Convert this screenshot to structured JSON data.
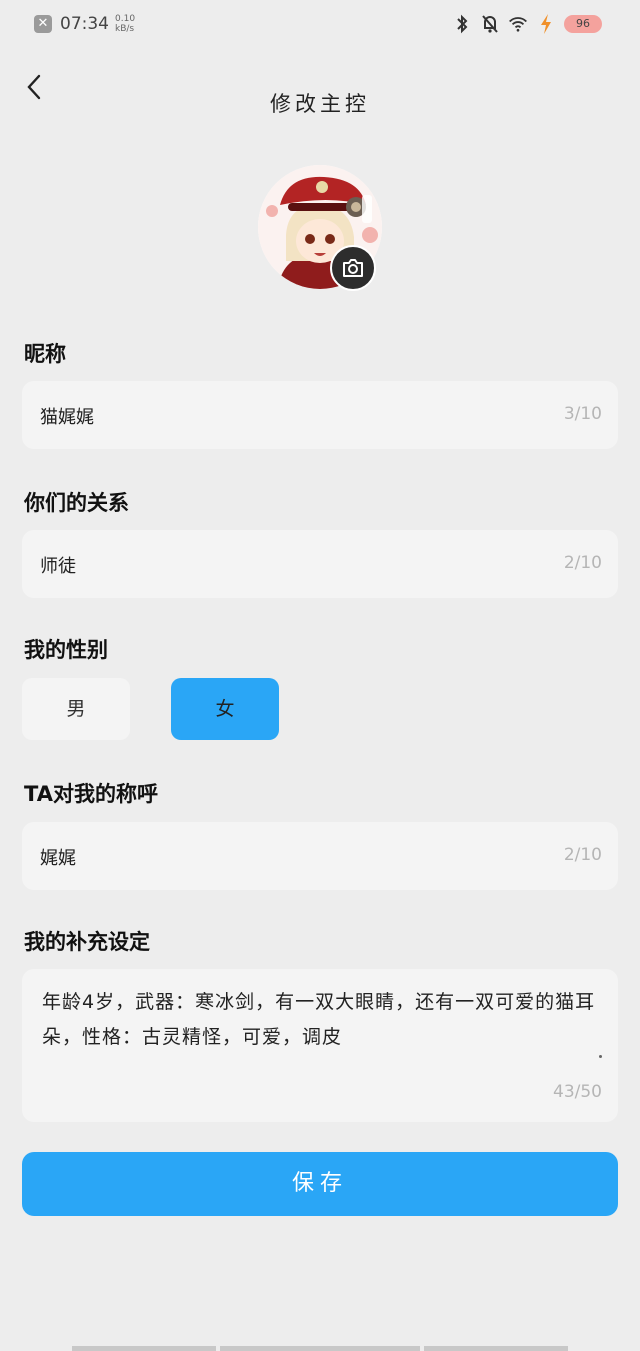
{
  "status": {
    "time": "07:34",
    "speed_value": "0.10",
    "speed_unit": "kB/s",
    "battery": "96"
  },
  "header": {
    "title": "修改主控"
  },
  "nickname": {
    "label": "昵称",
    "value": "猫娓娓",
    "count": "3/10"
  },
  "relation": {
    "label": "你们的关系",
    "value": "师徒",
    "count": "2/10"
  },
  "gender": {
    "label": "我的性别",
    "male": "男",
    "female": "女",
    "selected": "女"
  },
  "ta_call": {
    "label": "TA对我的称呼",
    "value": "娓娓",
    "count": "2/10"
  },
  "extra": {
    "label": "我的补充设定",
    "value": "年龄4岁，武器：寒冰剑，有一双大眼睛，还有一双可爱的猫耳朵，性格：古灵精怪，可爱，调皮",
    "count": "43/50"
  },
  "save_label": "保存",
  "colors": {
    "accent": "#2aa6f6",
    "background": "#ededed",
    "field": "#f4f4f4"
  }
}
